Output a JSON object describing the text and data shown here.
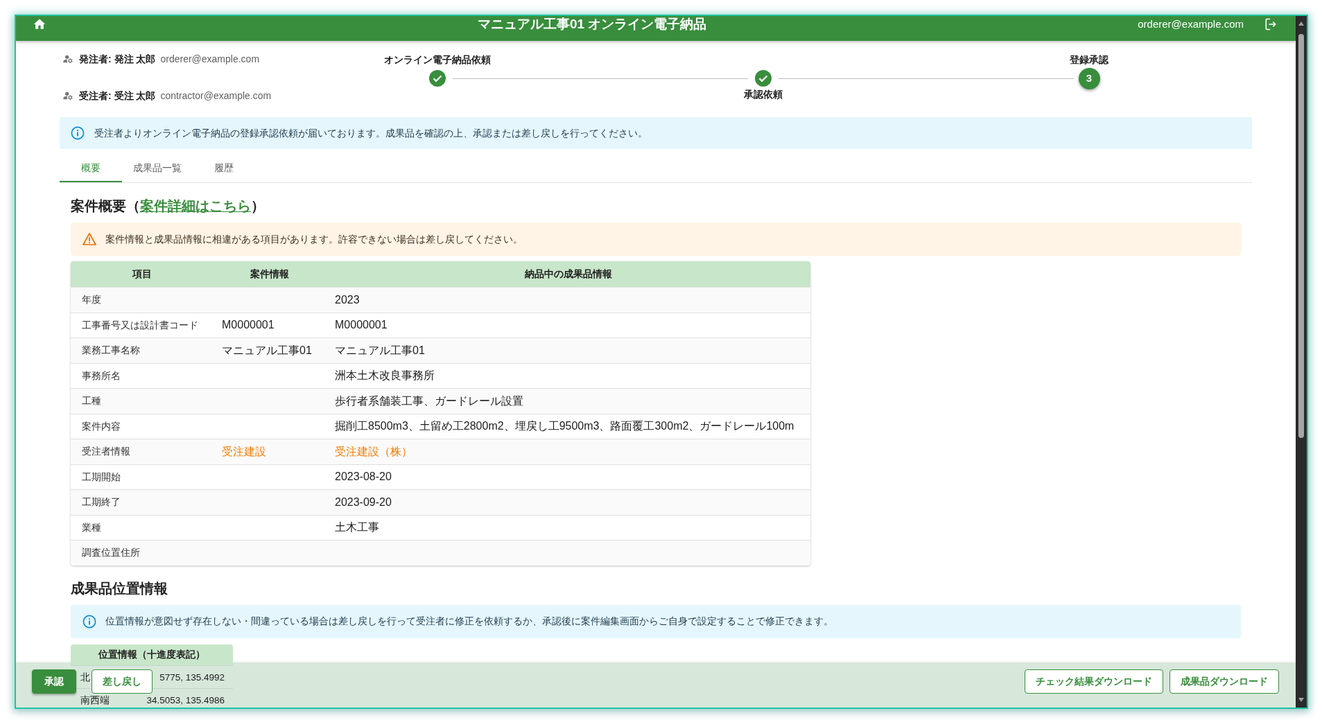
{
  "header": {
    "title": "マニュアル工事01 オンライン電子納品",
    "user_email": "orderer@example.com"
  },
  "parties": [
    {
      "label": "発注者: 発注 太郎",
      "email": "orderer@example.com"
    },
    {
      "label": "受注者: 受注 太郎",
      "email": "contractor@example.com"
    }
  ],
  "stepper": {
    "steps": [
      {
        "label": "オンライン電子納品依頼",
        "completed": true
      },
      {
        "label": "承認依頼",
        "completed": true
      },
      {
        "label": "登録承認",
        "completed": false,
        "number": "3"
      }
    ]
  },
  "notice": {
    "message": "受注者よりオンライン電子納品の登録承認依頼が届いております。成果品を確認の上、承認または差し戻しを行ってください。"
  },
  "tabs": [
    {
      "label": "概要",
      "selected": true
    },
    {
      "label": "成果品一覧",
      "selected": false
    },
    {
      "label": "履歴",
      "selected": false
    }
  ],
  "summary": {
    "heading": {
      "prefix": "案件概要（",
      "link": "案件詳細はこちら",
      "suffix": "）"
    },
    "warning": "案件情報と成果品情報に相違がある項目があります。許容できない場合は差し戻してください。",
    "table": {
      "columns": [
        "項目",
        "案件情報",
        "納品中の成果品情報"
      ],
      "rows": [
        {
          "item": "年度",
          "delivered": "2023",
          "mismatch": false
        },
        {
          "item": "工事番号又は設計書コード",
          "project": "M0000001",
          "delivered": "M0000001",
          "mismatch": false
        },
        {
          "item": "業務工事名称",
          "project": "マニュアル工事01",
          "delivered": "マニュアル工事01",
          "mismatch": false
        },
        {
          "item": "事務所名",
          "delivered": "洲本土木改良事務所",
          "mismatch": false
        },
        {
          "item": "工種",
          "delivered": "歩行者系舗装工事、ガードレール設置",
          "mismatch": false
        },
        {
          "item": "案件内容",
          "delivered": "掘削工8500m3、土留め工2800m2、埋戻し工9500m3、路面覆工300m2、ガードレール100m",
          "mismatch": false
        },
        {
          "item": "受注者情報",
          "project": "受注建設",
          "delivered": "受注建設（株）",
          "mismatch": true
        },
        {
          "item": "工期開始",
          "delivered": "2023-08-20",
          "mismatch": false
        },
        {
          "item": "工期終了",
          "delivered": "2023-09-20",
          "mismatch": false
        },
        {
          "item": "業種",
          "delivered": "土木工事",
          "mismatch": false
        },
        {
          "item": "調査位置住所"
        }
      ]
    }
  },
  "location": {
    "heading": "成果品位置情報",
    "info": "位置情報が意図せず存在しない・間違っている場合は差し戻しを行って受注者に修正を依頼するか、承認後に案件編集画面からご自身で設定することで修正できます。",
    "table": {
      "columns": [
        "位置情報（十進度表記）"
      ],
      "rows": [
        {
          "label": "北",
          "value": "5775, 135.4992"
        },
        {
          "label": "南西端",
          "value": "34.5053, 135.4986"
        }
      ]
    }
  },
  "action_bar": {
    "left_buttons": [
      {
        "label": "承認",
        "kind": "primary"
      },
      {
        "label": "差し戻し",
        "kind": "outline"
      }
    ],
    "right_buttons": [
      {
        "label": "チェック結果ダウンロード",
        "kind": "outline"
      },
      {
        "label": "成果品ダウンロード",
        "kind": "outline"
      }
    ]
  }
}
